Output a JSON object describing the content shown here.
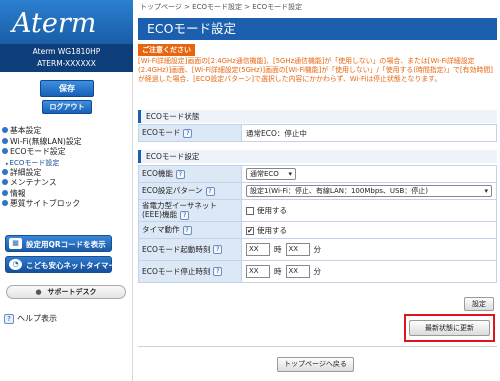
{
  "sidebar": {
    "logo": "Aterm",
    "model_line1": "Aterm WG1810HP",
    "model_line2": "ATERM-XXXXXX",
    "save_label": "保存",
    "logout_label": "ログアウト",
    "nav": [
      {
        "label": "基本設定"
      },
      {
        "label": "Wi-Fi(無線LAN)設定"
      },
      {
        "label": "ECOモード設定"
      }
    ],
    "nav_sub": "ECOモード設定",
    "nav2": [
      {
        "label": "詳細設定"
      },
      {
        "label": "メンテナンス"
      },
      {
        "label": "情報"
      },
      {
        "label": "悪質サイトブロック"
      }
    ],
    "qr_label": "設定用QRコードを表示",
    "timer_label": "こども安心ネットタイマー",
    "support_label": "サポートデスク",
    "help_label": "ヘルプ表示",
    "accent_color": "#1b5fae"
  },
  "main": {
    "breadcrumb": "トップページ > ECOモード設定 > ECOモード設定",
    "title": "ECOモード設定",
    "caution_label": "ご注意ください",
    "caution_text": "[Wi-Fi詳細設定]画面の[2.4GHz通信機能]、[5GHz通信機能]が「使用しない」の場合、または[Wi-Fi詳細設定(2.4GHz)]画面、[Wi-Fi詳細設定(5GHz)]画面の[Wi-Fi機能]が「使用しない」/「使用する(時間指定)」で[有効時間]が経過した場合、[ECO設定パターン]で選択した内容にかかわらず、Wi-Fiは停止状態となります。",
    "status_section": {
      "heading": "ECOモード状態",
      "label": "ECOモード",
      "value": "通常ECO：停止中"
    },
    "settings_section": {
      "heading": "ECOモード設定",
      "eco_function_label": "ECO機能",
      "eco_function_value": "通常ECO",
      "pattern_label": "ECO設定パターン",
      "pattern_value": "設定1(Wi-Fi：停止、有線LAN：100Mbps、USB：停止)",
      "power_ethernet_label1": "省電力型イーサネット",
      "power_ethernet_label2": "(EEE)機能",
      "power_ethernet_text": "使用する",
      "power_ethernet_checked": false,
      "timer_label": "タイマ動作",
      "timer_text": "使用する",
      "timer_checked": true,
      "start_label": "ECOモード起動時刻",
      "stop_label": "ECOモード停止時刻",
      "hour_value": "XX",
      "minute_value": "XX",
      "hour_unit": "時",
      "minute_unit": "分"
    },
    "set_button": "設定",
    "refresh_button": "最新状態に更新",
    "back_button": "トップページへ戻る",
    "highlight_color": "#e0141e",
    "caution_color": "#e8650f"
  },
  "icons": {
    "help": "?",
    "nav_bullet": "circle-bullet-icon",
    "qr": "qr-code-icon",
    "timer": "timer-icon",
    "check": "✔",
    "dropdown": "▾"
  }
}
